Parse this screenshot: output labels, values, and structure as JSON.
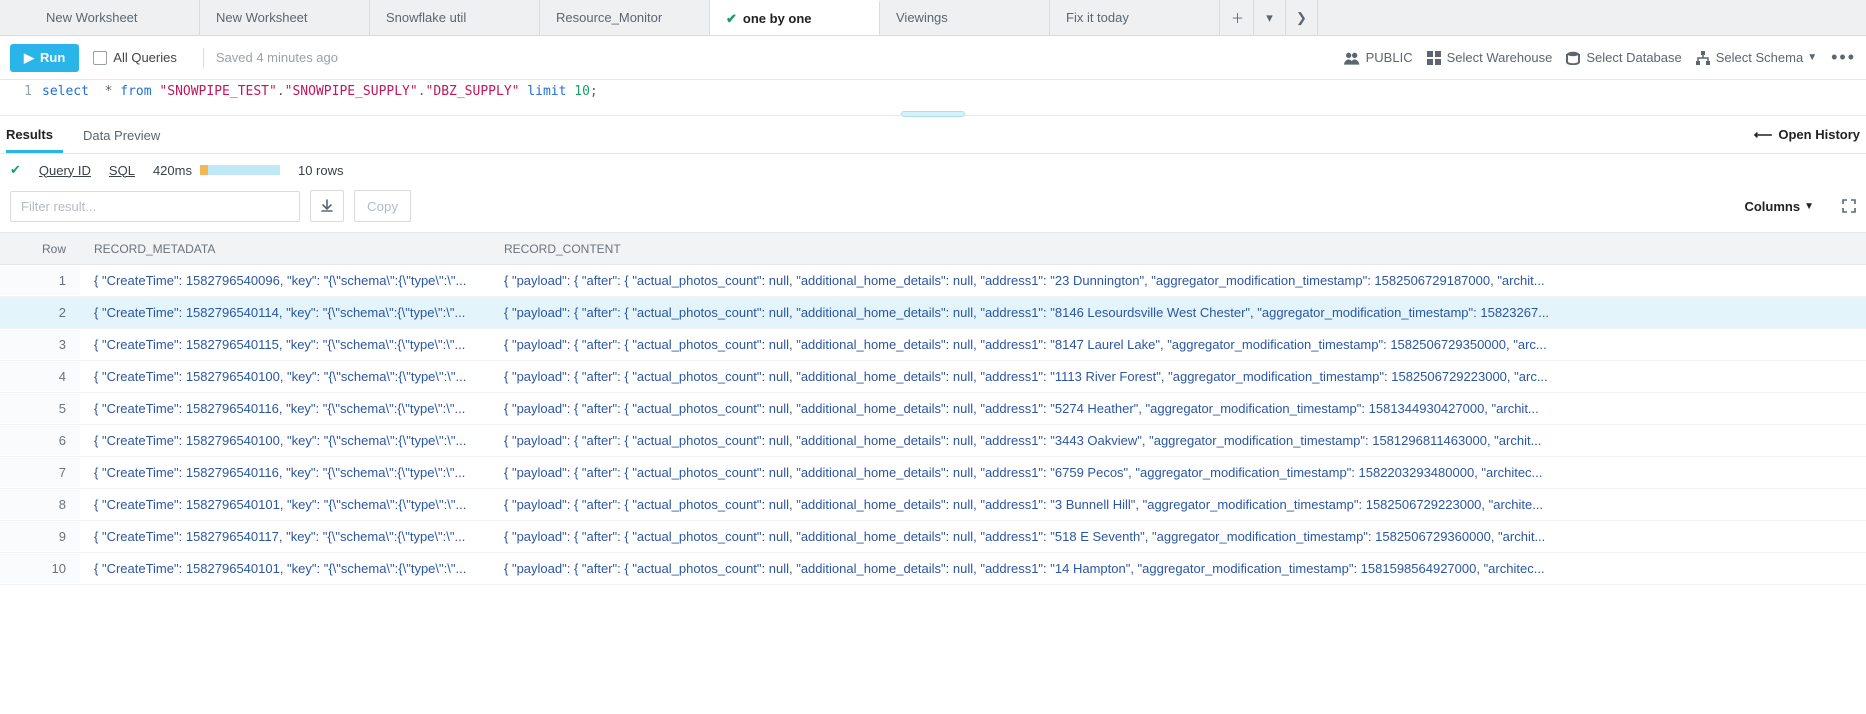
{
  "tabs": [
    {
      "label": "New Worksheet",
      "active": false,
      "check": false
    },
    {
      "label": "New Worksheet",
      "active": false,
      "check": false
    },
    {
      "label": "Snowflake util",
      "active": false,
      "check": false
    },
    {
      "label": "Resource_Monitor",
      "active": false,
      "check": false
    },
    {
      "label": "one by one",
      "active": true,
      "check": true
    },
    {
      "label": "Viewings",
      "active": false,
      "check": false
    },
    {
      "label": "Fix it today",
      "active": false,
      "check": false
    }
  ],
  "toolbar": {
    "run": "Run",
    "all_queries": "All Queries",
    "saved": "Saved 4 minutes ago",
    "role": "PUBLIC",
    "warehouse": "Select Warehouse",
    "database": "Select Database",
    "schema": "Select Schema"
  },
  "editor": {
    "line_no": "1",
    "sql_select": "select",
    "sql_star": "*",
    "sql_from": "from",
    "sql_str1": "\"SNOWPIPE_TEST\"",
    "sql_str2": "\"SNOWPIPE_SUPPLY\"",
    "sql_str3": "\"DBZ_SUPPLY\"",
    "sql_limit": "limit",
    "sql_num": "10"
  },
  "results_tabs": {
    "results": "Results",
    "preview": "Data Preview",
    "open_history": "Open History"
  },
  "stats": {
    "query_id": "Query ID",
    "sql_link": "SQL",
    "timing": "420ms",
    "rows": "10 rows"
  },
  "filter": {
    "placeholder": "Filter result...",
    "copy": "Copy",
    "columns": "Columns"
  },
  "grid": {
    "head_row": "Row",
    "head_meta": "RECORD_METADATA",
    "head_content": "RECORD_CONTENT",
    "rows": [
      {
        "n": "1",
        "selected": false,
        "meta": "{ \"CreateTime\": 1582796540096, \"key\": \"{\\\"schema\\\":{\\\"type\\\":\\\"...",
        "content": "{ \"payload\": { \"after\": { \"actual_photos_count\": null, \"additional_home_details\": null, \"address1\": \"23 Dunnington\", \"aggregator_modification_timestamp\": 1582506729187000, \"archit..."
      },
      {
        "n": "2",
        "selected": true,
        "meta": "{ \"CreateTime\": 1582796540114, \"key\": \"{\\\"schema\\\":{\\\"type\\\":\\\"...",
        "content": "{ \"payload\": { \"after\": { \"actual_photos_count\": null, \"additional_home_details\": null, \"address1\": \"8146 Lesourdsville West Chester\", \"aggregator_modification_timestamp\": 15823267..."
      },
      {
        "n": "3",
        "selected": false,
        "meta": "{ \"CreateTime\": 1582796540115, \"key\": \"{\\\"schema\\\":{\\\"type\\\":\\\"...",
        "content": "{ \"payload\": { \"after\": { \"actual_photos_count\": null, \"additional_home_details\": null, \"address1\": \"8147 Laurel Lake\", \"aggregator_modification_timestamp\": 1582506729350000, \"arc..."
      },
      {
        "n": "4",
        "selected": false,
        "meta": "{ \"CreateTime\": 1582796540100, \"key\": \"{\\\"schema\\\":{\\\"type\\\":\\\"...",
        "content": "{ \"payload\": { \"after\": { \"actual_photos_count\": null, \"additional_home_details\": null, \"address1\": \"1113 River Forest\", \"aggregator_modification_timestamp\": 1582506729223000, \"arc..."
      },
      {
        "n": "5",
        "selected": false,
        "meta": "{ \"CreateTime\": 1582796540116, \"key\": \"{\\\"schema\\\":{\\\"type\\\":\\\"...",
        "content": "{ \"payload\": { \"after\": { \"actual_photos_count\": null, \"additional_home_details\": null, \"address1\": \"5274 Heather\", \"aggregator_modification_timestamp\": 1581344930427000, \"archit..."
      },
      {
        "n": "6",
        "selected": false,
        "meta": "{ \"CreateTime\": 1582796540100, \"key\": \"{\\\"schema\\\":{\\\"type\\\":\\\"...",
        "content": "{ \"payload\": { \"after\": { \"actual_photos_count\": null, \"additional_home_details\": null, \"address1\": \"3443 Oakview\", \"aggregator_modification_timestamp\": 1581296811463000, \"archit..."
      },
      {
        "n": "7",
        "selected": false,
        "meta": "{ \"CreateTime\": 1582796540116, \"key\": \"{\\\"schema\\\":{\\\"type\\\":\\\"...",
        "content": "{ \"payload\": { \"after\": { \"actual_photos_count\": null, \"additional_home_details\": null, \"address1\": \"6759 Pecos\", \"aggregator_modification_timestamp\": 1582203293480000, \"architec..."
      },
      {
        "n": "8",
        "selected": false,
        "meta": "{ \"CreateTime\": 1582796540101, \"key\": \"{\\\"schema\\\":{\\\"type\\\":\\\"...",
        "content": "{ \"payload\": { \"after\": { \"actual_photos_count\": null, \"additional_home_details\": null, \"address1\": \"3 Bunnell Hill\", \"aggregator_modification_timestamp\": 1582506729223000, \"archite..."
      },
      {
        "n": "9",
        "selected": false,
        "meta": "{ \"CreateTime\": 1582796540117, \"key\": \"{\\\"schema\\\":{\\\"type\\\":\\\"...",
        "content": "{ \"payload\": { \"after\": { \"actual_photos_count\": null, \"additional_home_details\": null, \"address1\": \"518 E Seventh\", \"aggregator_modification_timestamp\": 1582506729360000, \"archit..."
      },
      {
        "n": "10",
        "selected": false,
        "meta": "{ \"CreateTime\": 1582796540101, \"key\": \"{\\\"schema\\\":{\\\"type\\\":\\\"...",
        "content": "{ \"payload\": { \"after\": { \"actual_photos_count\": null, \"additional_home_details\": null, \"address1\": \"14 Hampton\", \"aggregator_modification_timestamp\": 1581598564927000, \"architec..."
      }
    ]
  }
}
